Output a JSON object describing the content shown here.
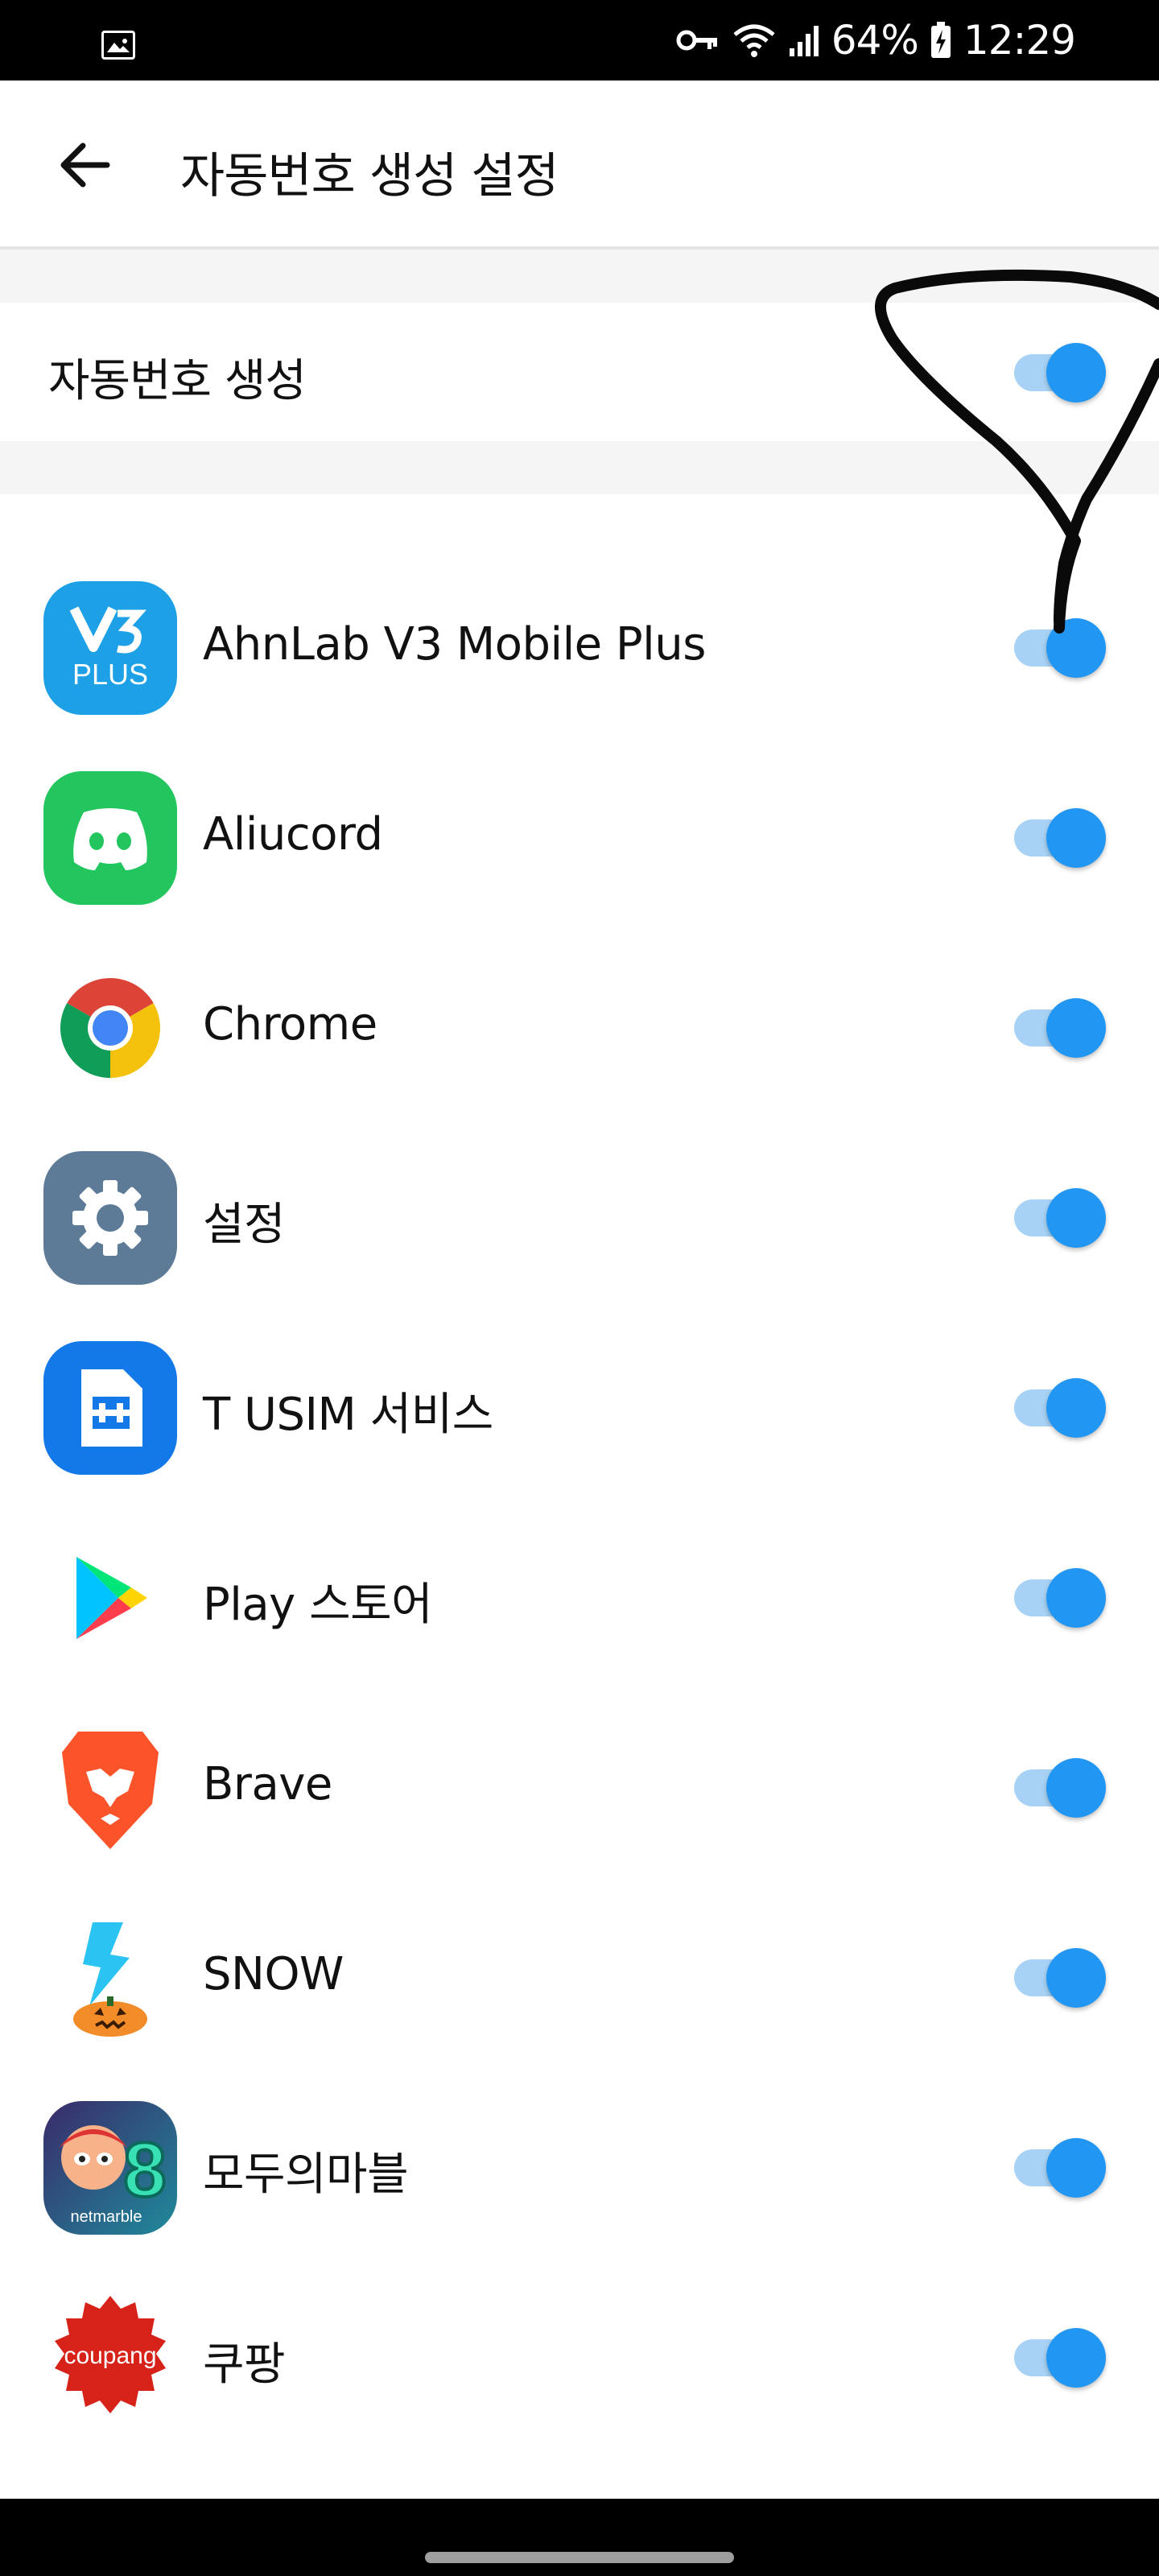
{
  "status_bar": {
    "battery": "64%",
    "time": "12:29",
    "icons": [
      "image-icon",
      "vpn-key-icon",
      "wifi-icon",
      "signal-icon",
      "battery-icon"
    ]
  },
  "app_bar": {
    "title": "자동번호 생성 설정",
    "back_icon": "arrow-left-icon"
  },
  "master": {
    "label": "자동번호 생성",
    "enabled": true
  },
  "apps": [
    {
      "label": "AhnLab V3 Mobile Plus",
      "enabled": true,
      "icon": "ahnlab-v3-icon",
      "icon_text": "PLUS"
    },
    {
      "label": "Aliucord",
      "enabled": true,
      "icon": "aliucord-icon"
    },
    {
      "label": "Chrome",
      "enabled": true,
      "icon": "chrome-icon"
    },
    {
      "label": "설정",
      "enabled": true,
      "icon": "settings-gear-icon"
    },
    {
      "label": "T USIM 서비스",
      "enabled": true,
      "icon": "t-usim-icon"
    },
    {
      "label": "Play 스토어",
      "enabled": true,
      "icon": "play-store-icon"
    },
    {
      "label": "Brave",
      "enabled": true,
      "icon": "brave-lion-icon"
    },
    {
      "label": "SNOW",
      "enabled": true,
      "icon": "snow-icon"
    },
    {
      "label": "모두의마블",
      "enabled": true,
      "icon": "modoo-marble-icon",
      "icon_text": "netmarble"
    },
    {
      "label": "쿠팡",
      "enabled": true,
      "icon": "coupang-icon",
      "icon_text": "coupang"
    }
  ],
  "colors": {
    "accent": "#2196f3",
    "track": "#a7d2f5",
    "status_bar": "#000000",
    "section_gap": "#f5f5f5"
  }
}
